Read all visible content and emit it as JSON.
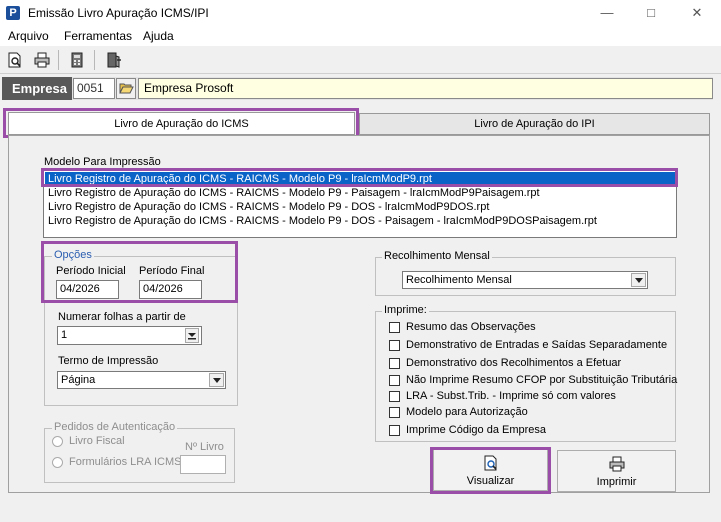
{
  "window": {
    "title": "Emissão Livro Apuração ICMS/IPI",
    "icon_letter": "P"
  },
  "menu": {
    "items": [
      "Arquivo",
      "Ferramentas",
      "Ajuda"
    ]
  },
  "toolbar": {
    "buttons": [
      "print-preview-icon",
      "printer-icon",
      "calculator-icon",
      "exit-door-icon"
    ]
  },
  "empresa": {
    "label": "Empresa",
    "code": "0051",
    "name": "Empresa Prosoft"
  },
  "tabs": [
    {
      "label": "Livro de Apuração do ICMS",
      "active": true
    },
    {
      "label": "Livro de Apuração do IPI",
      "active": false
    }
  ],
  "modelo": {
    "label": "Modelo Para Impressão",
    "items": [
      "Livro Registro de Apuração do ICMS - RAICMS - Modelo P9 - lraIcmModP9.rpt",
      "Livro Registro de Apuração do ICMS - RAICMS - Modelo P9 - Paisagem - lraIcmModP9Paisagem.rpt",
      "Livro Registro de Apuração do ICMS - RAICMS - Modelo P9 - DOS - lraIcmModP9DOS.rpt",
      "Livro Registro de Apuração do ICMS - RAICMS - Modelo P9 - DOS - Paisagem - lraIcmModP9DOSPaisagem.rpt"
    ],
    "selected_index": 0
  },
  "opcoes": {
    "title": "Opções",
    "periodo_inicial_label": "Período Inicial",
    "periodo_inicial": "04/2026",
    "periodo_final_label": "Período Final",
    "periodo_final": "04/2026",
    "numerar_label": "Numerar folhas a partir de",
    "numerar_value": "1",
    "termo_label": "Termo de Impressão",
    "termo_value": "Página"
  },
  "pedidos": {
    "title": "Pedidos de Autenticação",
    "livro_fiscal": "Livro Fiscal",
    "formularios": "Formulários LRA ICMS",
    "n_livro_label": "Nº Livro",
    "n_livro_value": ""
  },
  "recolhimento": {
    "title": "Recolhimento Mensal",
    "value": "Recolhimento Mensal"
  },
  "imprime": {
    "title": "Imprime:",
    "options": [
      "Resumo das Observações",
      "Demonstrativo de Entradas e Saídas Separadamente",
      "Demonstrativo dos Recolhimentos a Efetuar",
      "Não Imprime Resumo CFOP por Substituição Tributária",
      "LRA - Subst.Trib. - Imprime só com valores",
      "Modelo para Autorização",
      "Imprime Código da Empresa"
    ]
  },
  "buttons": {
    "visualizar": "Visualizar",
    "imprimir": "Imprimir"
  },
  "colors": {
    "accent_highlight": "#9b4ea8",
    "selection": "#0a64c8",
    "empresa_name_bg": "#ffffe1"
  }
}
